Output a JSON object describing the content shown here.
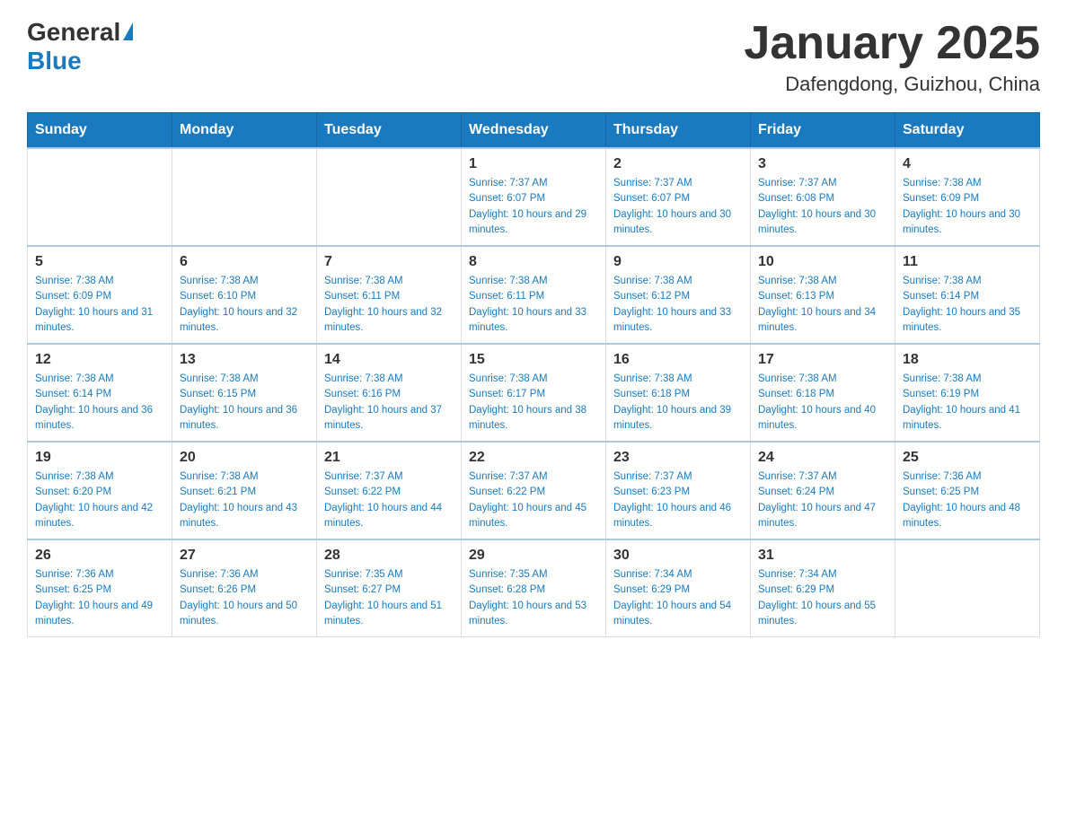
{
  "header": {
    "logo_general": "General",
    "logo_blue": "Blue",
    "title": "January 2025",
    "subtitle": "Dafengdong, Guizhou, China"
  },
  "days_of_week": [
    "Sunday",
    "Monday",
    "Tuesday",
    "Wednesday",
    "Thursday",
    "Friday",
    "Saturday"
  ],
  "weeks": [
    [
      {
        "day": "",
        "sunrise": "",
        "sunset": "",
        "daylight": ""
      },
      {
        "day": "",
        "sunrise": "",
        "sunset": "",
        "daylight": ""
      },
      {
        "day": "",
        "sunrise": "",
        "sunset": "",
        "daylight": ""
      },
      {
        "day": "1",
        "sunrise": "Sunrise: 7:37 AM",
        "sunset": "Sunset: 6:07 PM",
        "daylight": "Daylight: 10 hours and 29 minutes."
      },
      {
        "day": "2",
        "sunrise": "Sunrise: 7:37 AM",
        "sunset": "Sunset: 6:07 PM",
        "daylight": "Daylight: 10 hours and 30 minutes."
      },
      {
        "day": "3",
        "sunrise": "Sunrise: 7:37 AM",
        "sunset": "Sunset: 6:08 PM",
        "daylight": "Daylight: 10 hours and 30 minutes."
      },
      {
        "day": "4",
        "sunrise": "Sunrise: 7:38 AM",
        "sunset": "Sunset: 6:09 PM",
        "daylight": "Daylight: 10 hours and 30 minutes."
      }
    ],
    [
      {
        "day": "5",
        "sunrise": "Sunrise: 7:38 AM",
        "sunset": "Sunset: 6:09 PM",
        "daylight": "Daylight: 10 hours and 31 minutes."
      },
      {
        "day": "6",
        "sunrise": "Sunrise: 7:38 AM",
        "sunset": "Sunset: 6:10 PM",
        "daylight": "Daylight: 10 hours and 32 minutes."
      },
      {
        "day": "7",
        "sunrise": "Sunrise: 7:38 AM",
        "sunset": "Sunset: 6:11 PM",
        "daylight": "Daylight: 10 hours and 32 minutes."
      },
      {
        "day": "8",
        "sunrise": "Sunrise: 7:38 AM",
        "sunset": "Sunset: 6:11 PM",
        "daylight": "Daylight: 10 hours and 33 minutes."
      },
      {
        "day": "9",
        "sunrise": "Sunrise: 7:38 AM",
        "sunset": "Sunset: 6:12 PM",
        "daylight": "Daylight: 10 hours and 33 minutes."
      },
      {
        "day": "10",
        "sunrise": "Sunrise: 7:38 AM",
        "sunset": "Sunset: 6:13 PM",
        "daylight": "Daylight: 10 hours and 34 minutes."
      },
      {
        "day": "11",
        "sunrise": "Sunrise: 7:38 AM",
        "sunset": "Sunset: 6:14 PM",
        "daylight": "Daylight: 10 hours and 35 minutes."
      }
    ],
    [
      {
        "day": "12",
        "sunrise": "Sunrise: 7:38 AM",
        "sunset": "Sunset: 6:14 PM",
        "daylight": "Daylight: 10 hours and 36 minutes."
      },
      {
        "day": "13",
        "sunrise": "Sunrise: 7:38 AM",
        "sunset": "Sunset: 6:15 PM",
        "daylight": "Daylight: 10 hours and 36 minutes."
      },
      {
        "day": "14",
        "sunrise": "Sunrise: 7:38 AM",
        "sunset": "Sunset: 6:16 PM",
        "daylight": "Daylight: 10 hours and 37 minutes."
      },
      {
        "day": "15",
        "sunrise": "Sunrise: 7:38 AM",
        "sunset": "Sunset: 6:17 PM",
        "daylight": "Daylight: 10 hours and 38 minutes."
      },
      {
        "day": "16",
        "sunrise": "Sunrise: 7:38 AM",
        "sunset": "Sunset: 6:18 PM",
        "daylight": "Daylight: 10 hours and 39 minutes."
      },
      {
        "day": "17",
        "sunrise": "Sunrise: 7:38 AM",
        "sunset": "Sunset: 6:18 PM",
        "daylight": "Daylight: 10 hours and 40 minutes."
      },
      {
        "day": "18",
        "sunrise": "Sunrise: 7:38 AM",
        "sunset": "Sunset: 6:19 PM",
        "daylight": "Daylight: 10 hours and 41 minutes."
      }
    ],
    [
      {
        "day": "19",
        "sunrise": "Sunrise: 7:38 AM",
        "sunset": "Sunset: 6:20 PM",
        "daylight": "Daylight: 10 hours and 42 minutes."
      },
      {
        "day": "20",
        "sunrise": "Sunrise: 7:38 AM",
        "sunset": "Sunset: 6:21 PM",
        "daylight": "Daylight: 10 hours and 43 minutes."
      },
      {
        "day": "21",
        "sunrise": "Sunrise: 7:37 AM",
        "sunset": "Sunset: 6:22 PM",
        "daylight": "Daylight: 10 hours and 44 minutes."
      },
      {
        "day": "22",
        "sunrise": "Sunrise: 7:37 AM",
        "sunset": "Sunset: 6:22 PM",
        "daylight": "Daylight: 10 hours and 45 minutes."
      },
      {
        "day": "23",
        "sunrise": "Sunrise: 7:37 AM",
        "sunset": "Sunset: 6:23 PM",
        "daylight": "Daylight: 10 hours and 46 minutes."
      },
      {
        "day": "24",
        "sunrise": "Sunrise: 7:37 AM",
        "sunset": "Sunset: 6:24 PM",
        "daylight": "Daylight: 10 hours and 47 minutes."
      },
      {
        "day": "25",
        "sunrise": "Sunrise: 7:36 AM",
        "sunset": "Sunset: 6:25 PM",
        "daylight": "Daylight: 10 hours and 48 minutes."
      }
    ],
    [
      {
        "day": "26",
        "sunrise": "Sunrise: 7:36 AM",
        "sunset": "Sunset: 6:25 PM",
        "daylight": "Daylight: 10 hours and 49 minutes."
      },
      {
        "day": "27",
        "sunrise": "Sunrise: 7:36 AM",
        "sunset": "Sunset: 6:26 PM",
        "daylight": "Daylight: 10 hours and 50 minutes."
      },
      {
        "day": "28",
        "sunrise": "Sunrise: 7:35 AM",
        "sunset": "Sunset: 6:27 PM",
        "daylight": "Daylight: 10 hours and 51 minutes."
      },
      {
        "day": "29",
        "sunrise": "Sunrise: 7:35 AM",
        "sunset": "Sunset: 6:28 PM",
        "daylight": "Daylight: 10 hours and 53 minutes."
      },
      {
        "day": "30",
        "sunrise": "Sunrise: 7:34 AM",
        "sunset": "Sunset: 6:29 PM",
        "daylight": "Daylight: 10 hours and 54 minutes."
      },
      {
        "day": "31",
        "sunrise": "Sunrise: 7:34 AM",
        "sunset": "Sunset: 6:29 PM",
        "daylight": "Daylight: 10 hours and 55 minutes."
      },
      {
        "day": "",
        "sunrise": "",
        "sunset": "",
        "daylight": ""
      }
    ]
  ]
}
